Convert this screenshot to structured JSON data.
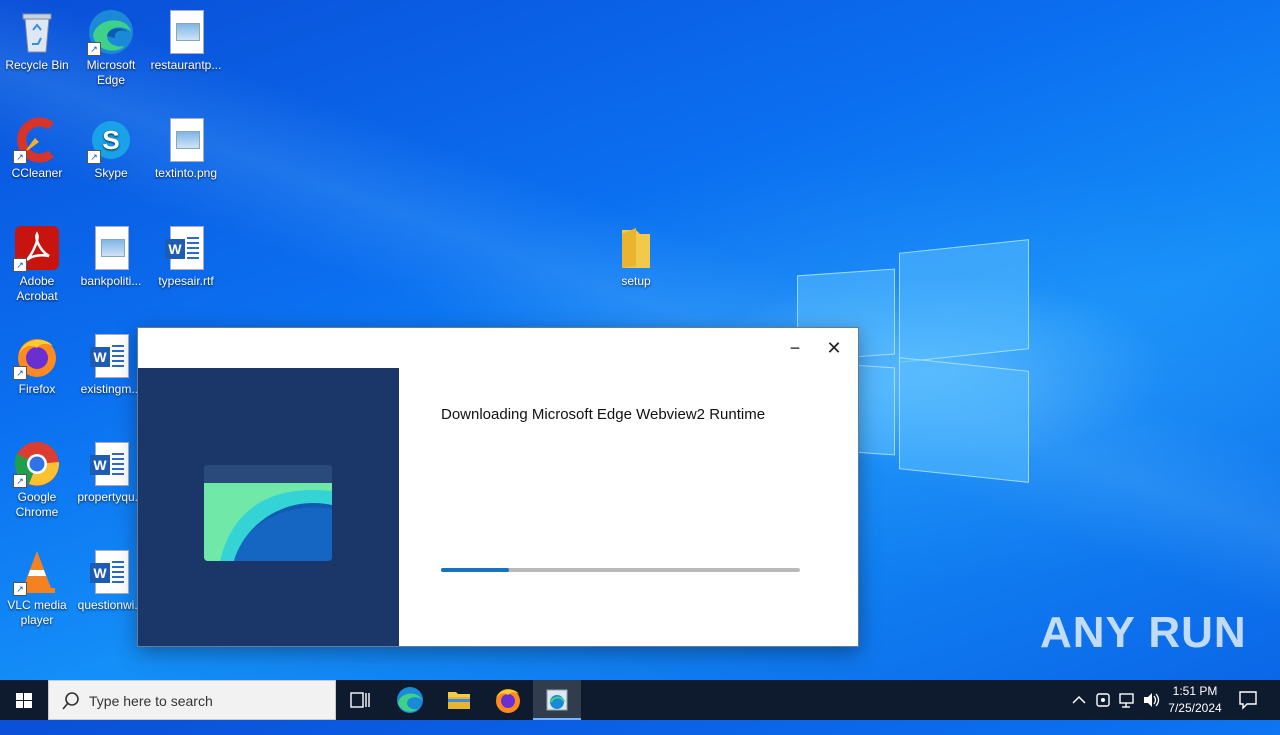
{
  "desktop": {
    "icons": [
      {
        "label": "Recycle Bin"
      },
      {
        "label": "Microsoft Edge"
      },
      {
        "label": "restaurantp..."
      },
      {
        "label": "CCleaner"
      },
      {
        "label": "Skype"
      },
      {
        "label": "textinto.png"
      },
      {
        "label": "Adobe Acrobat"
      },
      {
        "label": "bankpoliti..."
      },
      {
        "label": "typesair.rtf"
      },
      {
        "label": "setup"
      },
      {
        "label": "Firefox"
      },
      {
        "label": "existingm..."
      },
      {
        "label": "Google Chrome"
      },
      {
        "label": "propertyqu..."
      },
      {
        "label": "VLC media player"
      },
      {
        "label": "questionwi..."
      }
    ]
  },
  "installer": {
    "minimize_glyph": "−",
    "close_glyph": "✕",
    "heading": "Downloading Microsoft Edge Webview2 Runtime",
    "progress_fraction": 0.19
  },
  "watermark": {
    "text": "ANY RUN"
  },
  "taskbar": {
    "search_placeholder": "Type here to search",
    "pinned": [
      "task-view",
      "edge",
      "file-explorer",
      "firefox",
      "installer"
    ],
    "clock_time": "1:51 PM",
    "clock_date": "7/25/2024"
  },
  "colors": {
    "installer_side": "#1b3668",
    "progress": "#1773c0",
    "taskbar": "#0e1a2e"
  }
}
